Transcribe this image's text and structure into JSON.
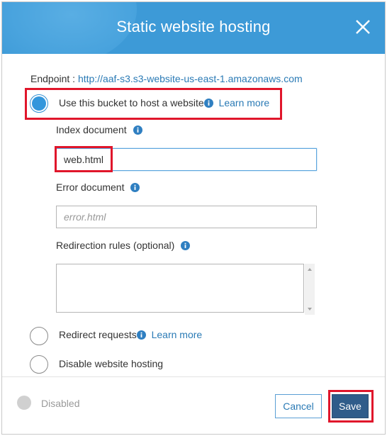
{
  "dialog": {
    "title": "Static website hosting"
  },
  "endpoint": {
    "label": "Endpoint :",
    "url": "http://aaf-s3.s3-website-us-east-1.amazonaws.com"
  },
  "options": {
    "host": {
      "label": "Use this bucket to host a website",
      "learn_more": "Learn more",
      "selected": true
    },
    "redirect": {
      "label": "Redirect requests",
      "learn_more": "Learn more",
      "selected": false
    },
    "disable": {
      "label": "Disable website hosting",
      "selected": false
    }
  },
  "fields": {
    "index_document": {
      "label": "Index document",
      "value": "web.html",
      "placeholder": ""
    },
    "error_document": {
      "label": "Error document",
      "value": "",
      "placeholder": "error.html"
    },
    "redirection_rules": {
      "label": "Redirection rules (optional)",
      "value": ""
    }
  },
  "footer": {
    "status_label": "Disabled",
    "cancel_label": "Cancel",
    "save_label": "Save"
  },
  "icons": {
    "info": "info-icon",
    "close": "close-icon"
  },
  "colors": {
    "header": "#3d9ad7",
    "link": "#2a7ab5",
    "highlight": "#e0162b",
    "save_button": "#2f5c8a"
  }
}
